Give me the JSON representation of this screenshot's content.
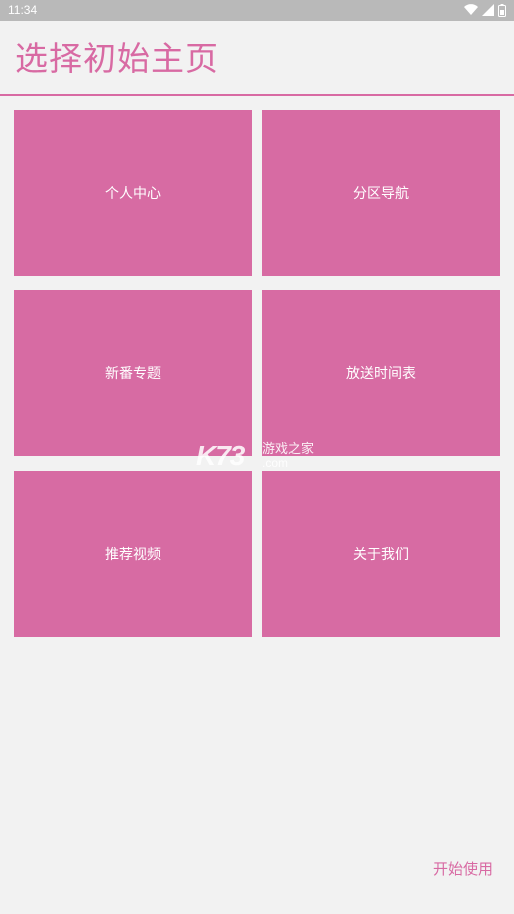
{
  "status_bar": {
    "time": "11:34",
    "icons": [
      "wifi-icon",
      "signal-icon",
      "battery-icon"
    ]
  },
  "title": "选择初始主页",
  "tiles": [
    {
      "label": "个人中心"
    },
    {
      "label": "分区导航"
    },
    {
      "label": "新番专题"
    },
    {
      "label": "放送时间表"
    },
    {
      "label": "推荐视频"
    },
    {
      "label": "关于我们"
    }
  ],
  "watermark": {
    "main": "K73",
    "sub1": "游戏之家",
    "sub2": ".com"
  },
  "start_button": "开始使用",
  "colors": {
    "accent": "#d86aa3",
    "tile": "#d76ba3",
    "background": "#f2f2f2",
    "status_bar": "#b9b9b9"
  }
}
